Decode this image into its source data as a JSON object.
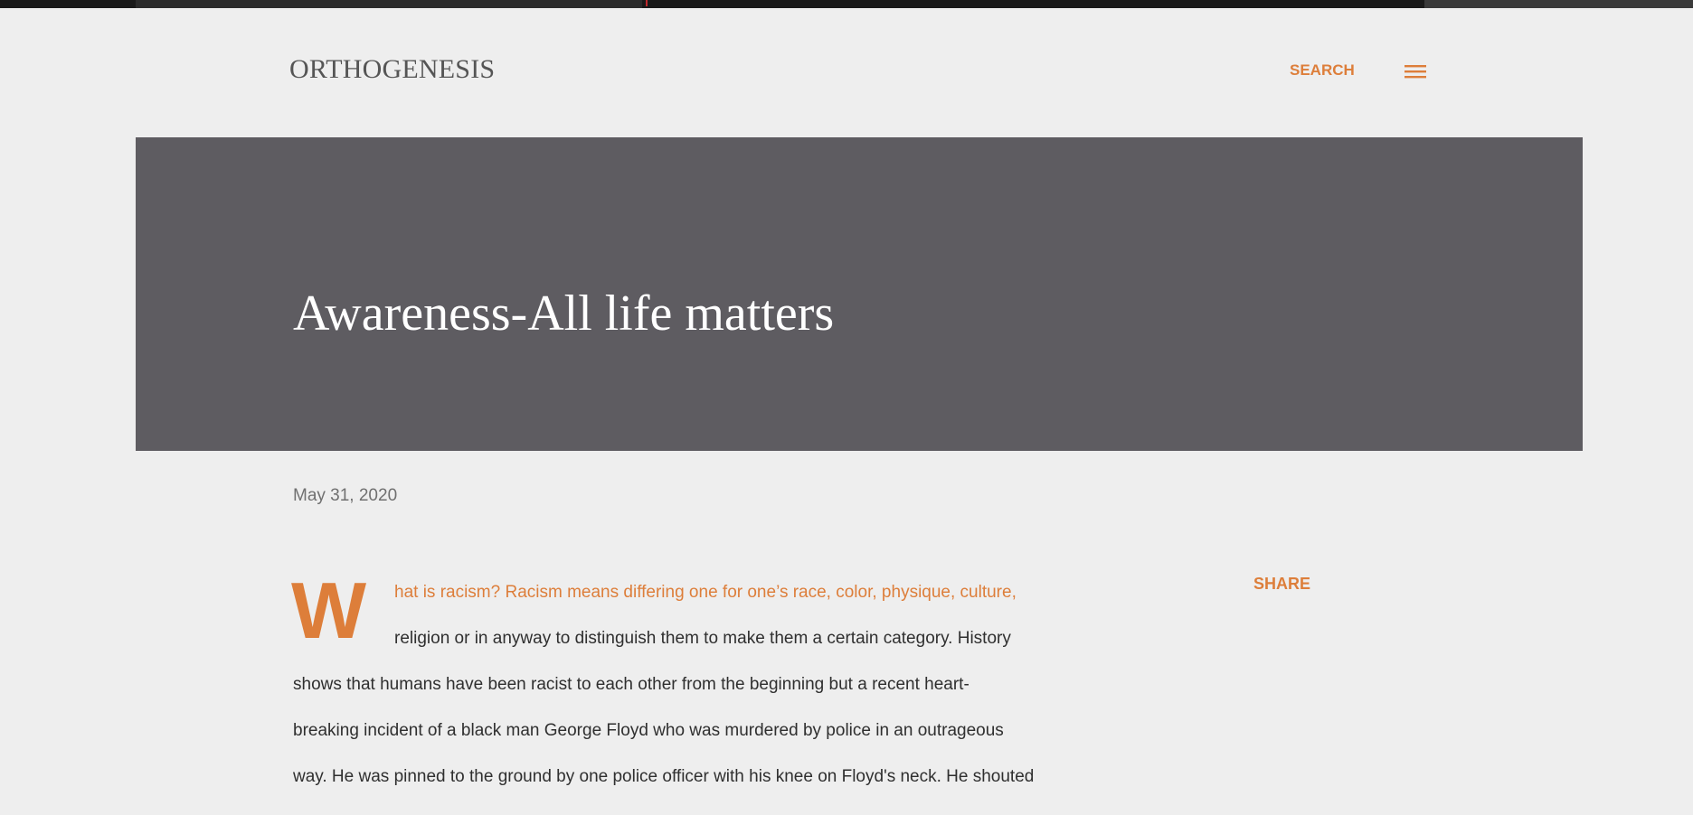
{
  "header": {
    "site_title": "ORTHOGENESIS",
    "search_label": "SEARCH",
    "menu_icon": "hamburger-menu-icon"
  },
  "hero": {
    "title": "Awareness-All life matters"
  },
  "post": {
    "date": "May 31, 2020",
    "share_label": "SHARE",
    "dropcap": "W",
    "lines": [
      "hat is racism? Racism means differing one for one’s race, color, physique, culture,",
      "religion or in anyway to distinguish them to make them a certain category. History",
      "shows that humans have been racist to each other from the beginning but a recent heart-",
      "breaking incident of a black man George Floyd who was murdered by police in an outrageous",
      "way. He was pinned to the ground by one police officer with his knee on Floyd's neck. He shouted"
    ]
  },
  "colors": {
    "accent": "#dd7e3a",
    "background": "#eeeeee",
    "hero_background": "#5e5c61",
    "title_text": "#555555",
    "body_text": "#2f2f2f"
  }
}
